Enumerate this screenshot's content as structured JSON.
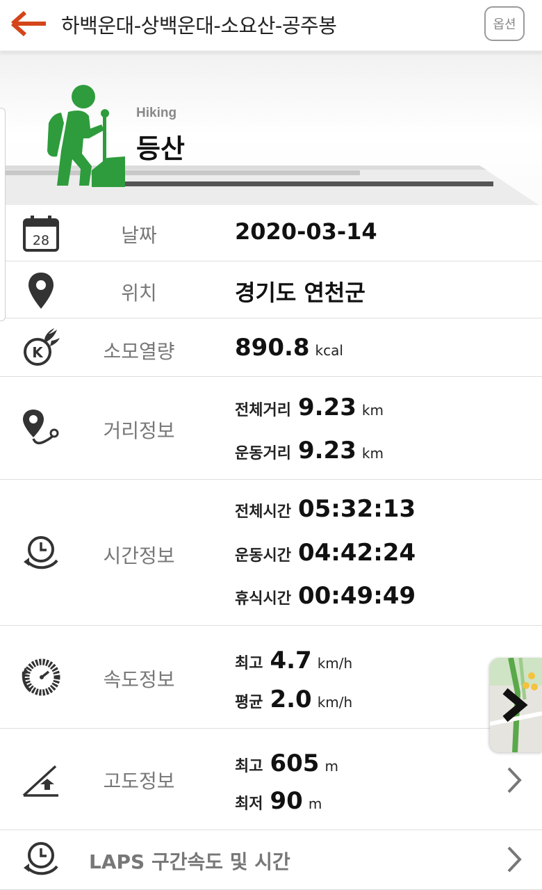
{
  "header": {
    "title": "하백운대-상백운대-소요산-공주봉",
    "option_label": "옵션",
    "accent_color": "#d4451a"
  },
  "hero": {
    "sub_label": "Hiking",
    "main_label": "등산",
    "icon_color": "#2e9c3c"
  },
  "calendar_day": "28",
  "rows": {
    "date": {
      "label": "날짜",
      "value": "2020-03-14"
    },
    "location": {
      "label": "위치",
      "value": "경기도 연천군"
    },
    "calories": {
      "label": "소모열량",
      "value": "890.8",
      "unit": "kcal"
    },
    "distance": {
      "label": "거리정보",
      "items": [
        {
          "key": "전체거리",
          "value": "9.23",
          "unit": "km"
        },
        {
          "key": "운동거리",
          "value": "9.23",
          "unit": "km"
        }
      ]
    },
    "time": {
      "label": "시간정보",
      "items": [
        {
          "key": "전체시간",
          "value": "05:32:13"
        },
        {
          "key": "운동시간",
          "value": "04:42:24"
        },
        {
          "key": "휴식시간",
          "value": "00:49:49"
        }
      ]
    },
    "speed": {
      "label": "속도정보",
      "items": [
        {
          "key": "최고",
          "value": "4.7",
          "unit": "km/h"
        },
        {
          "key": "평균",
          "value": "2.0",
          "unit": "km/h"
        }
      ]
    },
    "altitude": {
      "label": "고도정보",
      "items": [
        {
          "key": "최고",
          "value": "605",
          "unit": "m"
        },
        {
          "key": "최저",
          "value": "90",
          "unit": "m"
        }
      ]
    },
    "laps": {
      "label": "LAPS 구간속도 및 시간"
    }
  }
}
